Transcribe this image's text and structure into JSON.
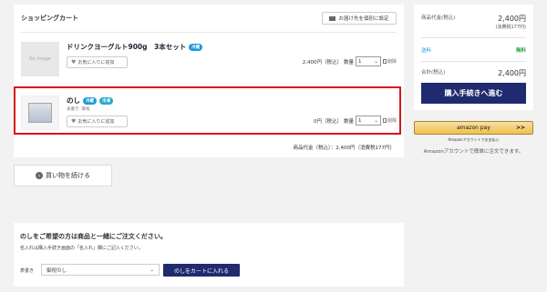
{
  "cart": {
    "title": "ショッピングカート",
    "ship_button": "お届け先を個別に設定",
    "items": [
      {
        "name": "ドリンクヨーグルト900g　3本セット",
        "tags": [
          "冷蔵"
        ],
        "thumb_text": "No Image",
        "fav": "お気に入りに追加",
        "price": "2,400円（税込）",
        "qty_label": "数量",
        "qty": "1",
        "delete": "削除"
      },
      {
        "name": "のし",
        "tags": [
          "冷蔵",
          "冷凍"
        ],
        "hyoki": "表書き: 御祝",
        "fav": "お気に入りに追加",
        "price": "0円（税込）",
        "qty_label": "数量",
        "qty": "1",
        "delete": "削除"
      }
    ],
    "subtotal": "商品代金（税込）：2,400円（消費税177円）"
  },
  "continue_button": "買い物を続ける",
  "noshi": {
    "title": "のしをご希望の方は商品と一緒にご注文ください。",
    "note": "名入れは購入手続き画面の「名入れ」欄にご記入ください。",
    "select_label": "表書き",
    "select_value": "御祝のし",
    "add_button": "のしをカートに入れる"
  },
  "summary": {
    "goods_label": "商品代金(税込)",
    "goods_value": "2,400円",
    "goods_tax": "(消費税177円)",
    "shipping_label": "送料",
    "shipping_value": "無料",
    "total_label": "合計(税込)",
    "total_value": "2,400円",
    "checkout": "購入手続きへ進む"
  },
  "amazon": {
    "button": "amazon pay",
    "arrows": ">>",
    "sub": "Amazonアカウントでお支払い",
    "note": "Amazonアカウントで簡単に注文できます。"
  },
  "colors": {
    "navy": "#1f2b6e",
    "highlight": "#d9161c",
    "cold_tag": "#1c9ad6",
    "free_shipping": "#2aa34a"
  }
}
